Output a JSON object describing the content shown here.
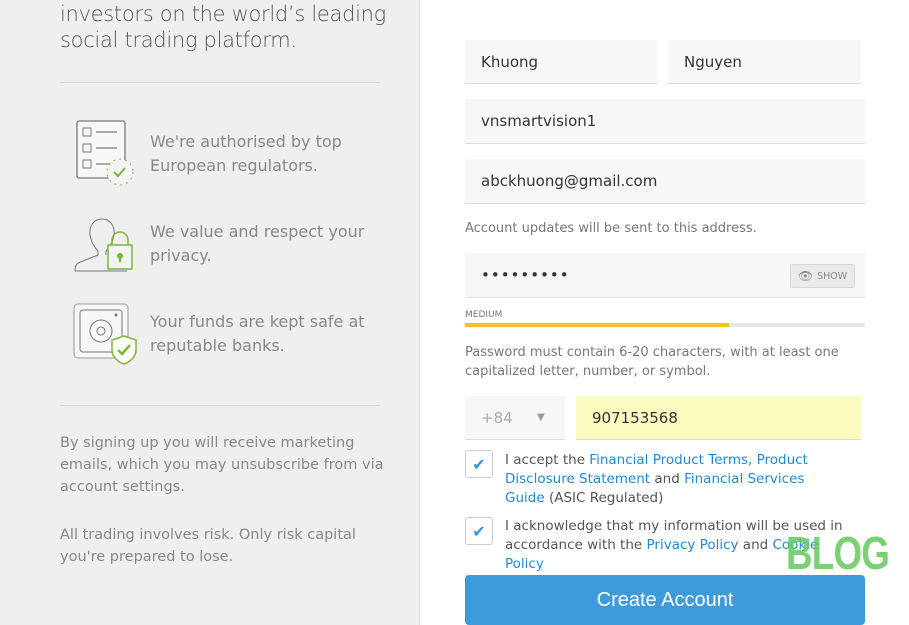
{
  "left": {
    "headline": [
      "investors on the world’s leading",
      "social trading platform."
    ],
    "features": [
      {
        "icon": "regulation-checklist-icon",
        "text": "We're authorised by top European regulators."
      },
      {
        "icon": "user-lock-icon",
        "text": "We value and respect your privacy."
      },
      {
        "icon": "safe-shield-icon",
        "text": "Your funds are kept safe at reputable banks."
      }
    ],
    "marketing_note": "By signing up you will receive marketing emails, which you may unsubscribe from via account settings.",
    "risk_note": "All trading involves risk. Only risk capital you're prepared to lose."
  },
  "form": {
    "first_name": "Khuong",
    "last_name": "Nguyen",
    "username": "vnsmartvision1",
    "email": "abckhuong@gmail.com",
    "email_note": "Account updates will be sent to this address.",
    "password": "•••••••••",
    "show_label": "SHOW",
    "strength_label": "MEDIUM",
    "strength_percent": 66,
    "strength_color": "#f0c419",
    "password_help": "Password must contain 6-20 characters, with at least one capitalized letter, number, or symbol.",
    "country_code": "+84",
    "phone": "907153568",
    "terms": {
      "prefix": "I accept the ",
      "link1": "Financial Product Terms, Product Disclosure Statement",
      "mid": " and ",
      "link2": "Financial Services Guide",
      "suffix": " (ASIC Regulated)",
      "checked": true
    },
    "privacy": {
      "prefix": "I acknowledge that my information will be used in accordance with the ",
      "link1": "Privacy Policy",
      "mid": " and ",
      "link2": "Cookie Policy",
      "checked": true
    },
    "submit_label": "Create Account"
  },
  "watermark": "BLOG",
  "colors": {
    "accent": "#3e9bdb",
    "link": "#1f8ad4",
    "green": "#7ab833",
    "phone_bg": "#f9fbbf"
  }
}
